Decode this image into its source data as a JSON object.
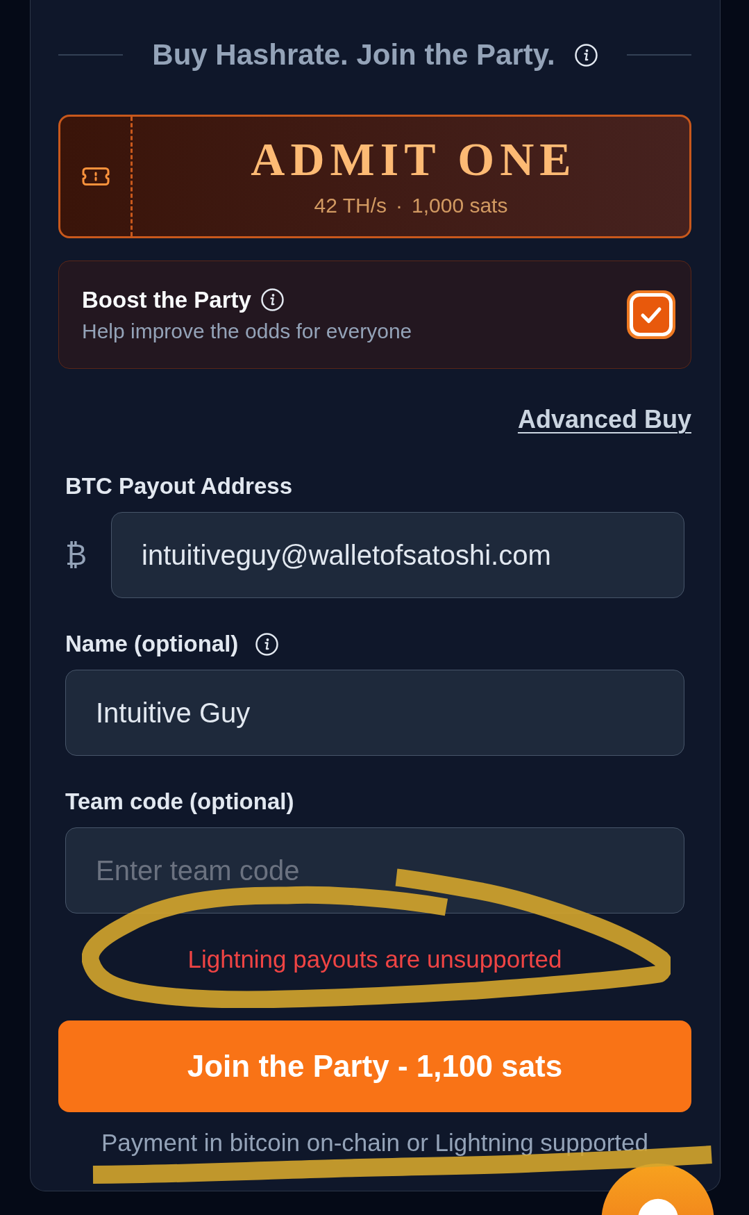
{
  "header": {
    "title": "Buy Hashrate. Join the Party.",
    "info": true
  },
  "ticket": {
    "title": "ADMIT ONE",
    "hashrate": "42 TH/s",
    "separator": "·",
    "price": "1,000 sats"
  },
  "boost": {
    "title": "Boost the Party",
    "info": true,
    "subtitle": "Help improve the odds for everyone",
    "checked": true
  },
  "advanced_link": "Advanced Buy",
  "fields": [
    {
      "label": "BTC Payout Address",
      "prefix": "₿",
      "value": "intuitiveguy@walletofsatoshi.com"
    },
    {
      "label": "Name (optional)",
      "info": true,
      "value": "Intuitive Guy"
    },
    {
      "label": "Team code (optional)",
      "placeholder": "Enter team code"
    }
  ],
  "error": "Lightning payouts are unsupported",
  "submit_button": "Join the Party - 1,100 sats",
  "payment_note": "Payment in bitcoin on-chain or Lightning supported"
}
